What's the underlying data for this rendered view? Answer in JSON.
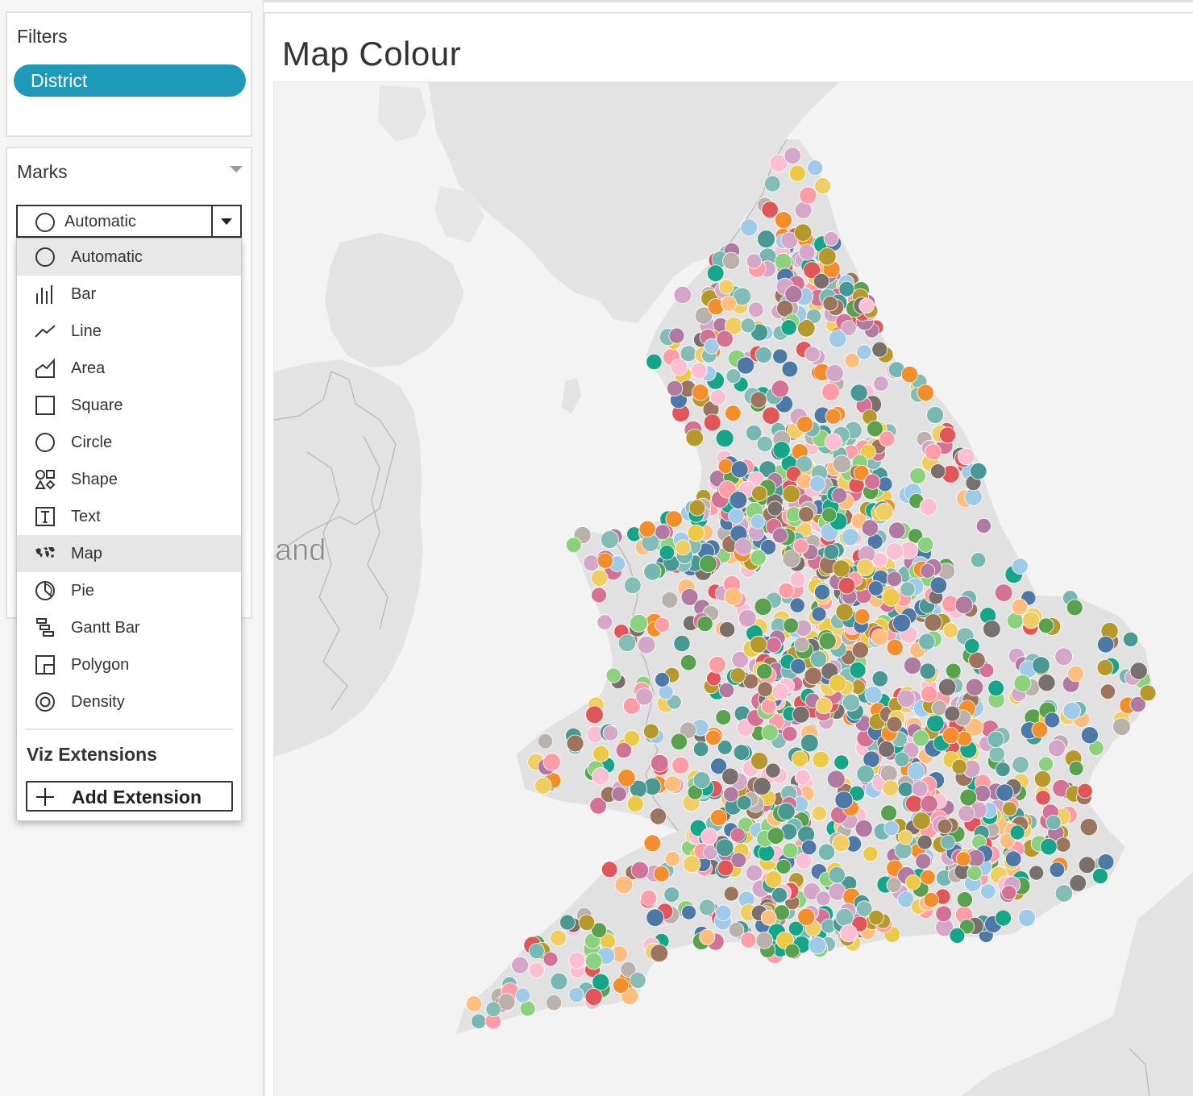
{
  "filters": {
    "title": "Filters",
    "pills": [
      {
        "label": "District",
        "color": "#1e9ab8"
      }
    ]
  },
  "marks": {
    "title": "Marks",
    "selected": {
      "label": "Automatic",
      "icon": "circle-outline-icon"
    },
    "menu": [
      {
        "label": "Automatic",
        "icon": "circle-outline-icon",
        "state": "selected"
      },
      {
        "label": "Bar",
        "icon": "bar-icon"
      },
      {
        "label": "Line",
        "icon": "line-icon"
      },
      {
        "label": "Area",
        "icon": "area-icon"
      },
      {
        "label": "Square",
        "icon": "square-icon"
      },
      {
        "label": "Circle",
        "icon": "circle-icon"
      },
      {
        "label": "Shape",
        "icon": "shape-icon"
      },
      {
        "label": "Text",
        "icon": "text-icon"
      },
      {
        "label": "Map",
        "icon": "map-icon",
        "state": "hover"
      },
      {
        "label": "Pie",
        "icon": "pie-icon"
      },
      {
        "label": "Gantt Bar",
        "icon": "gantt-bar-icon"
      },
      {
        "label": "Polygon",
        "icon": "polygon-icon"
      },
      {
        "label": "Density",
        "icon": "density-icon"
      }
    ],
    "extensions_heading": "Viz Extensions",
    "add_extension_label": "Add Extension"
  },
  "worksheet": {
    "title": "Map Colour",
    "map_label": "and"
  },
  "palette": [
    "#4e79a7",
    "#f28e2b",
    "#e15759",
    "#76b7b2",
    "#59a14f",
    "#edc948",
    "#b07aa1",
    "#ff9da7",
    "#9c755f",
    "#bab0ac",
    "#499894",
    "#86bcb6",
    "#8cd17d",
    "#b6992d",
    "#f1ce63",
    "#a0cbe8",
    "#ffbe7d",
    "#d37295",
    "#fabfd2",
    "#79706e",
    "#d4a6c8",
    "#17a589"
  ]
}
